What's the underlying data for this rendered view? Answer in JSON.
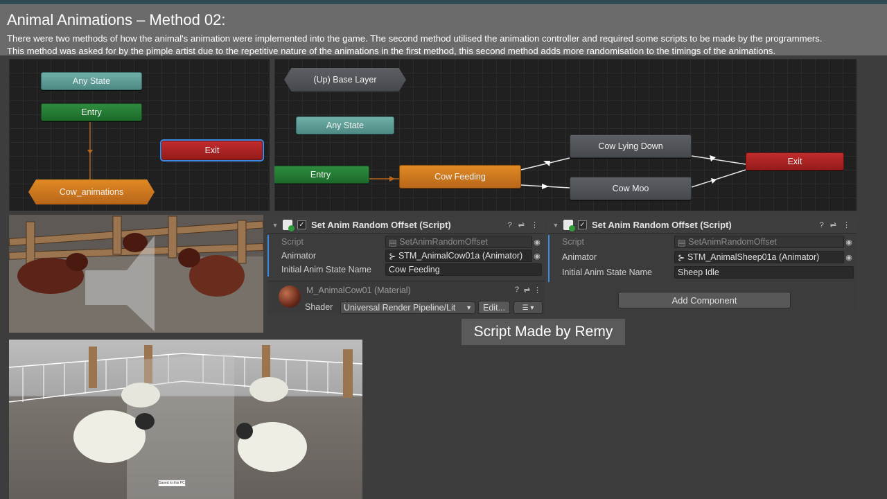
{
  "slide": {
    "title": "Animal Animations – Method 02:",
    "description_line1": "There were two methods of how the animal's animation were implemented into the game. The second method utilised the animation controller and required some scripts to be made by the programmers.",
    "description_line2": "This method was asked for by the pimple artist due to the repetitive nature of the animations in the first method, this second method adds more randomisation to the timings of the animations.",
    "caption": "Script Made by Remy"
  },
  "graph_left": {
    "any_state": "Any State",
    "entry": "Entry",
    "exit": "Exit",
    "cow_animations": "Cow_animations"
  },
  "graph_right": {
    "base_layer": "(Up) Base Layer",
    "any_state": "Any State",
    "entry": "Entry",
    "cow_feeding": "Cow Feeding",
    "cow_lying_down": "Cow Lying Down",
    "cow_moo": "Cow Moo",
    "exit": "Exit"
  },
  "inspector_cow": {
    "component_title": "Set Anim Random Offset (Script)",
    "script_label": "Script",
    "script_value": "SetAnimRandomOffset",
    "animator_label": "Animator",
    "animator_value": "STM_AnimalCow01a (Animator)",
    "state_label": "Initial Anim State Name",
    "state_value": "Cow Feeding",
    "material_name": "M_AnimalCow01 (Material)",
    "shader_label": "Shader",
    "shader_value": "Universal Render Pipeline/Lit",
    "edit_button": "Edit..."
  },
  "inspector_sheep": {
    "component_title": "Set Anim Random Offset (Script)",
    "script_label": "Script",
    "script_value": "SetAnimRandomOffset",
    "animator_label": "Animator",
    "animator_value": "STM_AnimalSheep01a (Animator)",
    "state_label": "Initial Anim State Name",
    "state_value": "Sheep Idle",
    "add_component": "Add Component"
  },
  "sheep_scene": {
    "saved_label": "Saved to this PC"
  },
  "colors": {
    "accent_blue": "#3c8ce7",
    "state_teal": "#5e9d96",
    "state_green": "#22783a",
    "state_red": "#aa2222",
    "state_orange": "#d27a20",
    "state_grey": "#50535a"
  }
}
